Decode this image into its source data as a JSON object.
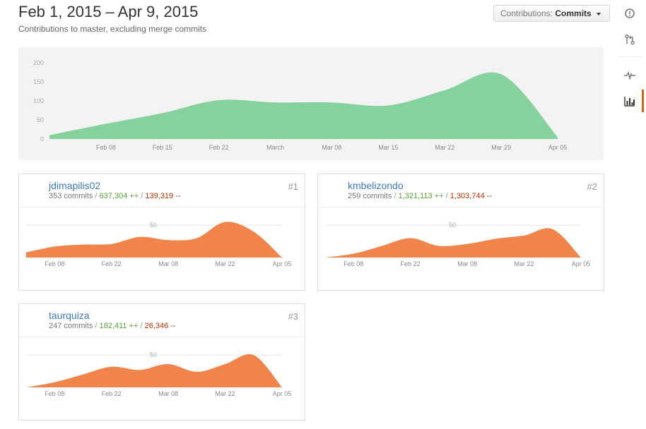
{
  "header": {
    "title": "Feb 1, 2015 – Apr 9, 2015",
    "subtitle": "Contributions to master, excluding merge commits"
  },
  "contributions_button": {
    "label": "Contributions:",
    "value": "Commits"
  },
  "side_nav": {
    "items": [
      {
        "icon": "issue-opened-icon"
      },
      {
        "icon": "git-pull-request-icon"
      },
      {
        "icon": "pulse-icon"
      },
      {
        "icon": "graph-icon",
        "selected": true
      }
    ],
    "accent": "#d26911"
  },
  "colors": {
    "main_area": "#86d29e",
    "user_area": "#f0844a",
    "link": "#4078c0",
    "additions": "#55a532",
    "deletions": "#bd2c00"
  },
  "chart_data": [
    {
      "type": "area",
      "title": "",
      "x": [
        "2015-02-01",
        "2015-02-08",
        "2015-02-15",
        "2015-02-22",
        "2015-03-01",
        "2015-03-08",
        "2015-03-15",
        "2015-03-22",
        "2015-03-29",
        "2015-04-05"
      ],
      "x_tick_labels": [
        "Feb 08",
        "Feb 15",
        "Feb 22",
        "March",
        "Mar 08",
        "Mar 15",
        "Mar 22",
        "Mar 29",
        "Apr 05"
      ],
      "values": [
        10,
        40,
        68,
        102,
        96,
        96,
        88,
        128,
        170,
        5
      ],
      "yticks": [
        0,
        50,
        100,
        150,
        200
      ],
      "ylim": [
        0,
        200
      ],
      "grid": true
    },
    {
      "type": "area",
      "x": [
        "2015-02-01",
        "2015-02-08",
        "2015-02-15",
        "2015-02-22",
        "2015-03-01",
        "2015-03-08",
        "2015-03-15",
        "2015-03-22",
        "2015-03-29",
        "2015-04-05"
      ],
      "x_tick_labels": [
        "Feb 08",
        "Feb 22",
        "Mar 08",
        "Mar 22",
        "Apr 05"
      ],
      "values": [
        8,
        17,
        20,
        21,
        32,
        27,
        30,
        55,
        40,
        0
      ],
      "yticks": [
        50
      ],
      "ylim": [
        0,
        60
      ]
    },
    {
      "type": "area",
      "x": [
        "2015-02-01",
        "2015-02-08",
        "2015-02-15",
        "2015-02-22",
        "2015-03-01",
        "2015-03-08",
        "2015-03-15",
        "2015-03-22",
        "2015-03-29",
        "2015-04-05"
      ],
      "x_tick_labels": [
        "Feb 08",
        "Feb 22",
        "Mar 08",
        "Mar 22",
        "Apr 05"
      ],
      "values": [
        0,
        6,
        18,
        30,
        18,
        21,
        29,
        34,
        44,
        0
      ],
      "yticks": [
        50
      ],
      "ylim": [
        0,
        60
      ]
    },
    {
      "type": "area",
      "x": [
        "2015-02-01",
        "2015-02-08",
        "2015-02-15",
        "2015-02-22",
        "2015-03-01",
        "2015-03-08",
        "2015-03-15",
        "2015-03-22",
        "2015-03-29",
        "2015-04-05"
      ],
      "x_tick_labels": [
        "Feb 08",
        "Feb 22",
        "Mar 08",
        "Mar 22",
        "Apr 05"
      ],
      "values": [
        0,
        8,
        20,
        32,
        27,
        36,
        24,
        36,
        50,
        0
      ],
      "yticks": [
        50
      ],
      "ylim": [
        0,
        60
      ]
    }
  ],
  "contributors": [
    {
      "login": "jdimapilis02",
      "commits": "353 commits",
      "additions": "637,304 ++",
      "deletions": "139,319 --",
      "rank": "#1",
      "sep": "/"
    },
    {
      "login": "kmbelizondo",
      "commits": "259 commits",
      "additions": "1,321,113 ++",
      "deletions": "1,303,744 --",
      "rank": "#2",
      "sep": "/"
    },
    {
      "login": "taurquiza",
      "commits": "247 commits",
      "additions": "182,411 ++",
      "deletions": "26,346 --",
      "rank": "#3",
      "sep": "/"
    }
  ]
}
